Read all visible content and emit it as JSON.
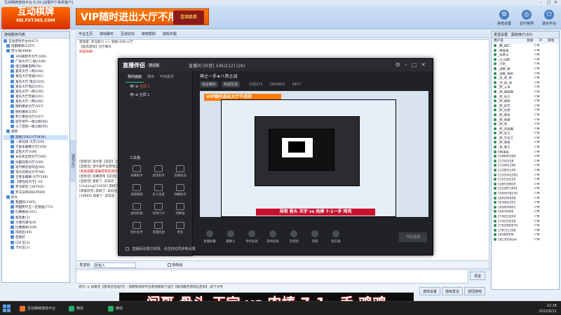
{
  "window": {
    "title": "互动棋牌游戏平台 6.29 [战报开户系统客户]"
  },
  "header": {
    "logo_line1": "互动棋牌",
    "logo_line2": "HD.FXT365.COM",
    "banner_text": "VIP随时进出大厅不用挤",
    "banner_badge": "互动会员",
    "buttons": [
      {
        "label": "系统设置",
        "icon": "gear-icon"
      },
      {
        "label": "访问官网",
        "icon": "globe-icon"
      },
      {
        "label": "退出平台",
        "icon": "exit-icon"
      }
    ]
  },
  "left": {
    "tab": "游戏服务列表",
    "tree": [
      "互动游戏平台(6417)",
      "成都麻将(1207)",
      "梦斗地(4068)",
      "300级新手大厅(106)",
      "广安大厅(二级)(106)",
      "电信锦集电网(76)",
      "嘉年大厅一网(106)",
      "富岛大厅普通(101)",
      "富岛大厅-电信(101)",
      "富岛大厅电信(101)",
      "富岛大厅一网(106)",
      "富岛大厅普通(101)",
      "富岛大厅一网(106)",
      "随机模式大厅(107)",
      "随机模式(105)",
      "死亡模式大厅(107)",
      "后外场不一眼之眼(96)",
      "斗了后院一眼之眼(95)",
      "黑桃",
      "黑桃(106)入厅(839)",
      "一季马场-大厅(100)",
      "千金争霸赛大厅(100)",
      "全钻大厅(106)",
      "★乐亮全场大厅(106)",
      "乐趣前景大厅(106)",
      "迭代精灵谷同台(95)",
      "等头前景过大厅(94)",
      "王者争霸赛-大厅(106)",
      "【我在纪大厅】(6)",
      "罗马新空 21674(2)",
      "罗马法则(8819500)",
      "四大",
      "我国际(1345)",
      "明国民代王一区德益(771)",
      "比赛模式(311)",
      "超高象(1)",
      "大家的源允(4)",
      "比赛模式(109)",
      "闲杂区(40)",
      "鱼类好",
      "CDI 区(2)",
      "卡片区(1)"
    ],
    "vertical_tab": "游戏大厅"
  },
  "center": {
    "tabs": [
      "平台主页",
      "游戏聊天",
      "互动论坛",
      "使用帮助",
      "游戏专题"
    ],
    "room_path": "游戏室: 罗马新川 >> 黑桃(106)入厅",
    "room_name": "【金昌游戏】大厅聊天",
    "notice_red": "欢迎你来!",
    "chat_lines": [
      "[直接话] 请大家【说话】之说",
      "[直接话] 请大家平台游戏之说",
      "[系统提醒]该做游戏在进行的游戏成功出现,",
      "[直接话] 说做游戏【说话】,",
      "[直接话] 黑桃丁: 说说话",
      "[chuJiang123456] 黑桃丁: 说",
      "[简报玩笑] 黑桃丁: 说说话",
      "[19660] 黑桃丁: 说说话"
    ],
    "send_label": "发送自:",
    "send_target": "所有人",
    "checkbox_label": "悄悄话",
    "send_button": "发送",
    "status_text": "提示: ◎ 如果在【游戏已经运行】: 请销售商标平台游戏数据下运行【解决服务游戏已启动】,适下文件",
    "bottom_buttons": [
      "游戏设置",
      "游戏发言",
      "返回游戏"
    ]
  },
  "right": {
    "tabs": [
      "发送设置",
      "黑桃用户(10)"
    ],
    "col_headers": [
      "用户名",
      "星级",
      "IP",
      "游戏"
    ],
    "users": [
      {
        "name": "_聚_甜乙",
        "level": "少将"
      },
      {
        "name": "_聊会乘_",
        "level": "少将"
      },
      {
        "name": "_西奇王",
        "level": "少将"
      },
      {
        "name": "_oI_回郎",
        "level": "少将"
      },
      {
        "name": "_小虾_",
        "level": "少将"
      },
      {
        "name": "_温暖_春",
        "level": "少将"
      },
      {
        "name": "_温暖_春秋",
        "level": "少将"
      },
      {
        "name": "_风_来_雪",
        "level": "少将"
      },
      {
        "name": "_冲_出_海",
        "level": "少将"
      },
      {
        "name": "_熊_上海",
        "level": "少将"
      },
      {
        "name": "_熊_国国际",
        "level": "少将"
      },
      {
        "name": "_熊_信义",
        "level": "少将"
      },
      {
        "name": "_熊_国际",
        "level": "少将"
      },
      {
        "name": "_熊_生竹",
        "level": "少将"
      },
      {
        "name": "_熊_化意",
        "level": "少将"
      },
      {
        "name": "_熊_鱼信",
        "level": "少将"
      },
      {
        "name": "_熊_老婆",
        "level": "少将"
      },
      {
        "name": "_熊_雪",
        "level": "少将"
      },
      {
        "name": "_熊_刘德鑫",
        "level": "少将"
      },
      {
        "name": "_熊_生工",
        "level": "少将"
      },
      {
        "name": "_熊_文名三",
        "level": "少将"
      },
      {
        "name": "_熊_德情",
        "level": "少将"
      },
      {
        "name": "_熊_家之",
        "level": "少将"
      },
      {
        "name": "E哈里星",
        "level": "少将"
      },
      {
        "name": "15960016B",
        "level": "少将"
      },
      {
        "name": "11742528",
        "level": "少将"
      },
      {
        "name": "112901196",
        "level": "少将"
      },
      {
        "name": "112891149",
        "level": "少将"
      },
      {
        "name": "11355011B3",
        "level": "少将"
      },
      {
        "name": "113150120",
        "level": "少将"
      },
      {
        "name": "14BT20B20",
        "level": "少将"
      },
      {
        "name": "1512BT1001",
        "level": "少将"
      },
      {
        "name": "1595678230",
        "level": "少将"
      },
      {
        "name": "16029500B",
        "level": "少将"
      },
      {
        "name": "163962303",
        "level": "少将"
      },
      {
        "name": "165600005",
        "level": "少将"
      },
      {
        "name": "16970000",
        "level": "少将"
      },
      {
        "name": "174203204",
        "level": "少将"
      },
      {
        "name": "17427025B",
        "level": "少将"
      },
      {
        "name": "17629B0075",
        "level": "少将"
      },
      {
        "name": "17B711308",
        "level": "少将"
      },
      {
        "name": "1B360000",
        "level": "少将"
      },
      {
        "name": "181305dcko",
        "level": "少将"
      }
    ]
  },
  "live": {
    "app_name": "直播伴侣",
    "version": "测试版",
    "room_title": "直播间 [抖音] 1461[12] (26)",
    "scene_tabs": [
      "我的画面",
      "媒体",
      "可用素材"
    ],
    "sources": [
      "全屏 1",
      "全屏 1"
    ],
    "stream_title": "神之一手★八哥之战",
    "tags": [
      "综合娱乐",
      "欢迎互动"
    ],
    "stats": [
      "订阅273",
      "1650601",
      "3477"
    ],
    "tools_label": "工具箱",
    "tools": [
      "屏幕助手",
      "游戏助手",
      "直播码流",
      "视频播放",
      "多人连麦",
      "弹幕助手",
      "虚拟形象",
      "进场口令",
      "弹幕盒",
      "图片助手",
      "直播回放",
      "更多"
    ],
    "notice": "直播码设置已修改，点击自动同步新设置",
    "preview_banner": "VIP随时进出大厅不用挤",
    "preview_caption": "闯哥 骨头 天宇 vs 肉棒 7-1一手 鸡鸡",
    "bottom": [
      "直播屏幕",
      "摄像头",
      "手机投屏",
      "游戏投屏",
      "音视频",
      "话筒",
      "扬声器"
    ],
    "start_label": "开始直播"
  },
  "caption": "闯哥 骨头 天宇 vs 肉棒 7-1一手 鸡鸡",
  "taskbar": {
    "items": [
      "互动棋牌游戏平台",
      "微信",
      "微信"
    ],
    "time": "22:26",
    "date": "2022/6/11"
  }
}
